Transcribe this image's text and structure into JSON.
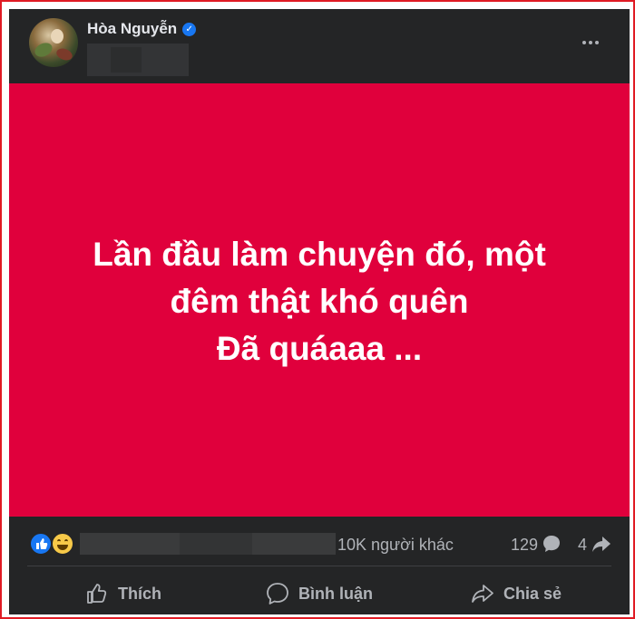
{
  "post": {
    "author_name": "Hòa Nguyễn",
    "text_lines": [
      "Lần đầu làm chuyện đó, một",
      "đêm thật khó quên",
      "Đã quáaaa ..."
    ],
    "background_color": "#e0003c"
  },
  "stats": {
    "reactions_icons": [
      "like-reaction-icon",
      "haha-reaction-icon"
    ],
    "others_text": "10K người khác",
    "comment_count": "129",
    "share_count": "4"
  },
  "actions": {
    "like_label": "Thích",
    "comment_label": "Bình luận",
    "share_label": "Chia sẻ"
  },
  "colors": {
    "card_bg": "#242526",
    "text_secondary": "#b0b3b8",
    "verified_blue": "#1877f2"
  }
}
